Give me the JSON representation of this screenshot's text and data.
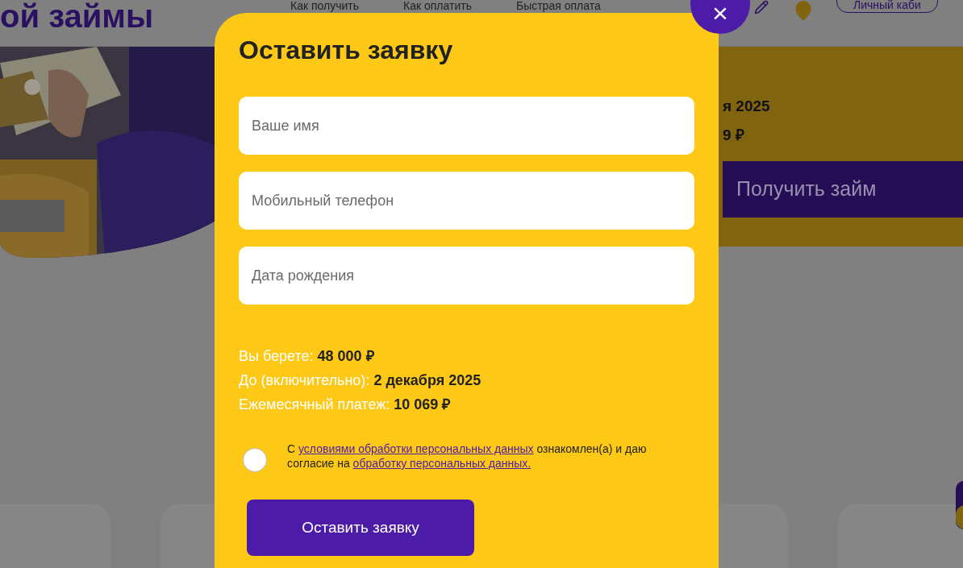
{
  "background_page": {
    "heading": "ой займы",
    "nav": [
      "Как получить",
      "Как оплатить",
      "Быстрая оплата"
    ],
    "account_button": "Личный каби",
    "summary_card": {
      "lines": [
        "я 2025",
        "9 ₽"
      ],
      "button": "Получить займ"
    }
  },
  "modal": {
    "title": "Оставить заявку",
    "close": "×",
    "fields": [
      {
        "placeholder": "Ваше имя"
      },
      {
        "placeholder": "Мобильный телефон"
      },
      {
        "placeholder": "Дата рождения"
      }
    ],
    "summary": [
      {
        "label": "Вы берете:",
        "value": "48 000 ₽"
      },
      {
        "label": "До (включительно):",
        "value": "2 декабря 2025"
      },
      {
        "label": "Ежемесячный платеж:",
        "value": "10 069 ₽"
      }
    ],
    "consent": {
      "checked": false,
      "text_before": "С",
      "link_1": "условиями обработки персональных данных",
      "text_middle": "ознакомлен(а) и даю согласие на",
      "link_2": "обработку персональных данных."
    },
    "submit": "Оставить заявку"
  }
}
